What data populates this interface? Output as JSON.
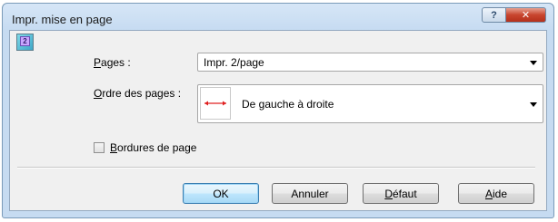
{
  "window": {
    "title": "Impr. mise en page",
    "help_glyph": "?",
    "close_glyph": "✕"
  },
  "pages": {
    "label_hotkey": "P",
    "label_rest": "ages :",
    "value": "Impr. 2/page"
  },
  "page_order": {
    "label_hotkey": "O",
    "label_rest": "rdre des pages :",
    "value": "De gauche à droite"
  },
  "page_borders": {
    "label_hotkey": "B",
    "label_rest": "ordures de page",
    "checked": false
  },
  "buttons": {
    "ok": "OK",
    "cancel": "Annuler",
    "default_hotkey": "D",
    "default_rest": "éfaut",
    "help_hotkey": "A",
    "help_rest": "ide"
  },
  "colors": {
    "order_arrow": "#e02020",
    "frame": "#c6dbf1",
    "close_button": "#c8452e"
  },
  "icons": [
    "app-page-icon",
    "help-icon",
    "close-icon",
    "dropdown-arrow-icon",
    "left-to-right-order-icon"
  ]
}
